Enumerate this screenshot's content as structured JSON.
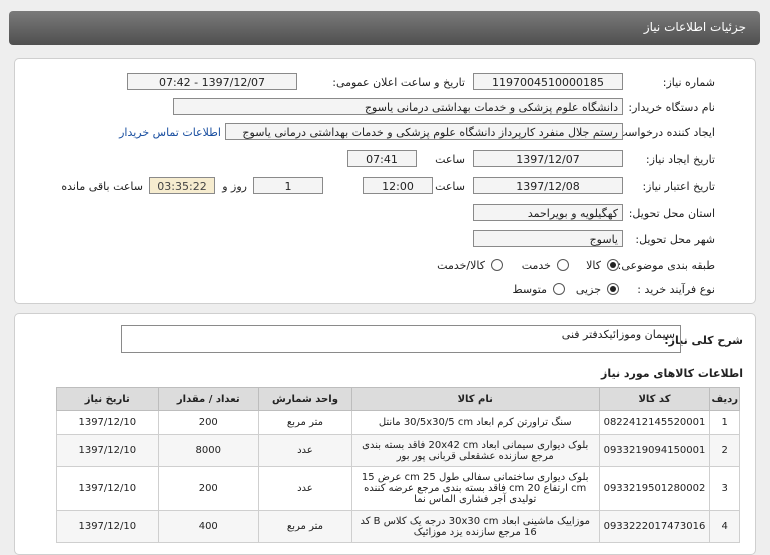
{
  "header": {
    "title": "جزئیات اطلاعات نیاز"
  },
  "form": {
    "need_number_label": "شماره نیاز:",
    "need_number": "1197004510000185",
    "announce_label": "تاریخ و ساعت اعلان عمومی:",
    "announce_value": "1397/12/07 - 07:42",
    "buyer_label": "نام دستگاه خریدار:",
    "buyer": "دانشگاه علوم پزشکی و خدمات بهداشتی درمانی یاسوج",
    "creator_label": "ایجاد کننده درخواست:",
    "creator": "رستم جلال منفرد کارپرداز دانشگاه علوم پزشکی و خدمات بهداشتی درمانی یاسوج",
    "contact_link": "اطلاعات تماس خریدار",
    "create_date_label": "تاریخ ایجاد نیاز:",
    "create_date": "1397/12/07",
    "time_label": "ساعت",
    "create_time": "07:41",
    "valid_date_label": "تاریخ اعتبار نیاز:",
    "valid_date": "1397/12/08",
    "valid_time": "12:00",
    "days": "1",
    "days_label": "روز و",
    "remaining": "03:35:22",
    "remaining_label": "ساعت باقی مانده",
    "province_label": "استان محل تحویل:",
    "province": "کهگیلویه و بویراحمد",
    "city_label": "شهر محل تحویل:",
    "city": "یاسوج",
    "category_label": "طبقه بندی موضوعی:",
    "cat_goods": "کالا",
    "cat_service": "خدمت",
    "cat_both": "کالا/خدمت",
    "process_label": "نوع فرآیند خرید :",
    "proc_partial": "جزیی",
    "proc_medium": "متوسط"
  },
  "summary": {
    "title": "شرح کلی نیاز:",
    "text": "سیمان وموزائیکدفتر فنی"
  },
  "goods": {
    "title": "اطلاعات کالاهای مورد نیاز",
    "columns": [
      "ردیف",
      "کد کالا",
      "نام کالا",
      "واحد شمارش",
      "تعداد / مقدار",
      "تاریخ نیاز"
    ],
    "rows": [
      {
        "idx": "1",
        "code": "0822412145520001",
        "name": "سنگ تراورتن کرم ابعاد 30/5x30/5 cm مانتل",
        "unit": "متر مربع",
        "qty": "200",
        "date": "1397/12/10"
      },
      {
        "idx": "2",
        "code": "0933219094150001",
        "name": "بلوک دیواری سیمانی ابعاد 20x42 cm فاقد بسته بندی مرجع سازنده عشقعلی قربانی پور بور",
        "unit": "عدد",
        "qty": "8000",
        "date": "1397/12/10"
      },
      {
        "idx": "3",
        "code": "0933219501280002",
        "name": "بلوک دیواری ساختمانی سفالی طول 25 cm عرض 15 cm ارتفاع 20 cm فاقد بسته بندی مرجع عرضه کننده تولیدی آجر فشاری الماس نما",
        "unit": "عدد",
        "qty": "200",
        "date": "1397/12/10"
      },
      {
        "idx": "4",
        "code": "0933222017473016",
        "name": "موزاییک ماشینی ابعاد 30x30 cm درجه یک کلاس B کد 16 مرجع سازنده یزد موزائیک",
        "unit": "متر مربع",
        "qty": "400",
        "date": "1397/12/10"
      }
    ]
  }
}
